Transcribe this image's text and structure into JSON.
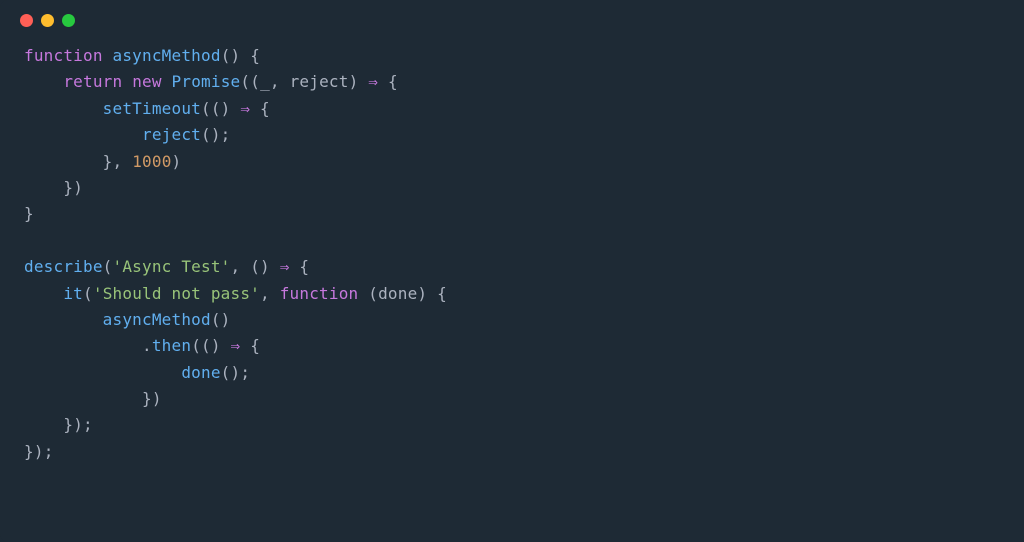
{
  "window": {
    "dots": [
      "red",
      "yellow",
      "green"
    ]
  },
  "code": {
    "tokens": {
      "function": "function",
      "asyncMethod": "asyncMethod",
      "return": "return",
      "new": "new",
      "Promise": "Promise",
      "underscore": "_",
      "rejectParam": "reject",
      "arrow": "⇒",
      "setTimeout": "setTimeout",
      "rejectCall": "reject",
      "timeout": "1000",
      "describe": "describe",
      "asyncTestStr": "'Async Test'",
      "it": "it",
      "shouldNotPassStr": "'Should not pass'",
      "functionKw": "function",
      "done": "done",
      "asyncMethodCall": "asyncMethod",
      "then": "then",
      "doneCall": "done",
      "openParen": "(",
      "closeParen": ")",
      "openBrace": "{",
      "closeBrace": "}",
      "emptyParens": "()",
      "comma": ",",
      "semicolon": ";",
      "dot": ".",
      "space": " "
    }
  }
}
